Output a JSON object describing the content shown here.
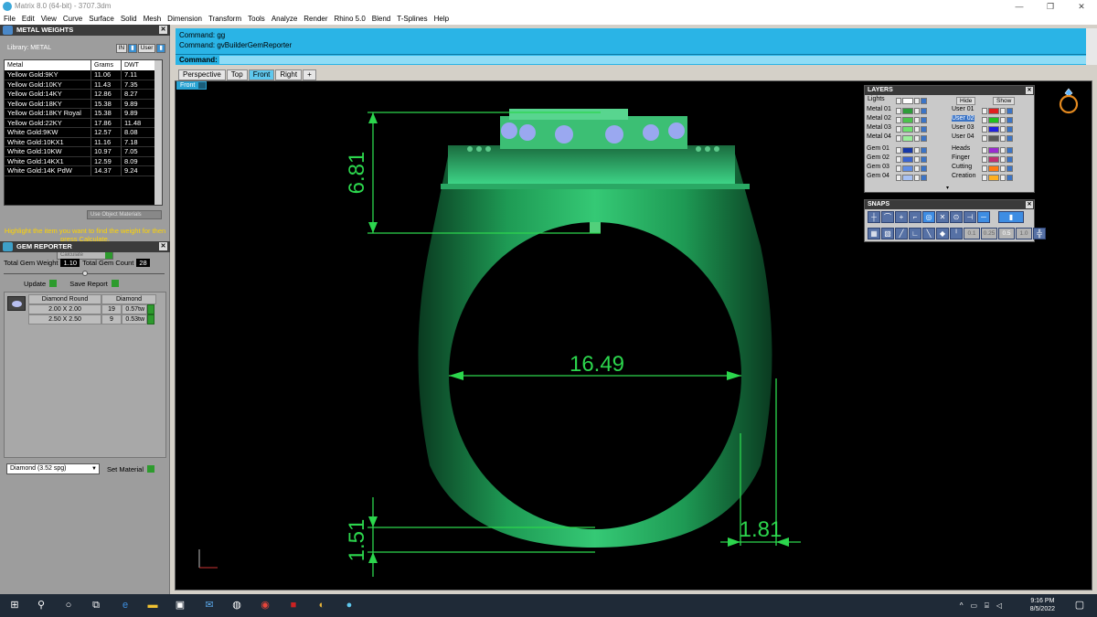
{
  "window": {
    "title": "Matrix 8.0 (64-bit) - 3707.3dm",
    "controls": [
      "—",
      "❐",
      "✕"
    ]
  },
  "menu": [
    "File",
    "Edit",
    "View",
    "Curve",
    "Surface",
    "Solid",
    "Mesh",
    "Dimension",
    "Transform",
    "Tools",
    "Analyze",
    "Render",
    "Rhino 5.0",
    "Blend",
    "T-Splines",
    "Help"
  ],
  "metal_weights": {
    "title": "METAL WEIGHTS",
    "library_label": "Library: METAL",
    "tabs": [
      "IN",
      "User"
    ],
    "columns": [
      "Metal",
      "Grams",
      "DWT"
    ],
    "rows": [
      [
        "Yellow Gold:9KY",
        "11.06",
        "7.11"
      ],
      [
        "Yellow Gold:10KY",
        "11.43",
        "7.35"
      ],
      [
        "Yellow Gold:14KY",
        "12.86",
        "8.27"
      ],
      [
        "Yellow Gold:18KY",
        "15.38",
        "9.89"
      ],
      [
        "Yellow Gold:18KY Royal",
        "15.38",
        "9.89"
      ],
      [
        "Yellow Gold:22KY",
        "17.86",
        "11.48"
      ],
      [
        "White Gold:9KW",
        "12.57",
        "8.08"
      ],
      [
        "White Gold:10KX1",
        "11.16",
        "7.18"
      ],
      [
        "White Gold:10KW",
        "10.97",
        "7.05"
      ],
      [
        "White Gold:14KX1",
        "12.59",
        "8.09"
      ],
      [
        "White Gold:14K PdW",
        "14.37",
        "9.24"
      ]
    ],
    "use_object_materials": "Use Object Materials",
    "hint": "Highlight the item you want to find the weight for then press Calculate.",
    "calculate": "Calculate"
  },
  "gem_reporter": {
    "title": "GEM REPORTER",
    "total_weight_label": "Total Gem Weight",
    "total_weight": "1.10",
    "total_count_label": "Total Gem Count",
    "total_count": "28",
    "update": "Update",
    "save_report": "Save Report",
    "col_shape": "Diamond Round",
    "col_material": "Diamond",
    "rows": [
      {
        "size": "2.00 X 2.00",
        "count": "19",
        "weight": "0.57tw"
      },
      {
        "size": "2.50 X 2.50",
        "count": "9",
        "weight": "0.53tw"
      }
    ],
    "material_select": "Diamond     (3.52 spg)",
    "set_material": "Set Material"
  },
  "command": {
    "history": [
      "Command: gg",
      "Command: gvBuilderGemReporter"
    ],
    "prompt_label": "Command:"
  },
  "view_tabs": [
    "Perspective",
    "Top",
    "Front",
    "Right",
    "+"
  ],
  "active_view": "Front",
  "dimensions": {
    "top_height": "6.81",
    "inner_diameter": "16.49",
    "bottom_thickness": "1.51",
    "side_width": "1.81"
  },
  "layers": {
    "title": "LAYERS",
    "lights": "Lights",
    "hide": "Hide",
    "show": "Show",
    "left": [
      {
        "name": "Metal 01",
        "color": "#2e9c3a"
      },
      {
        "name": "Metal 02",
        "color": "#4cc24c"
      },
      {
        "name": "Metal 03",
        "color": "#6fe26f"
      },
      {
        "name": "Metal 04",
        "color": "#9bef9b"
      },
      {
        "name": "Gem 01",
        "color": "#1638a8"
      },
      {
        "name": "Gem 02",
        "color": "#3a64d0"
      },
      {
        "name": "Gem 03",
        "color": "#5f8de6"
      },
      {
        "name": "Gem 04",
        "color": "#a7c1f3"
      }
    ],
    "right": [
      {
        "name": "User 01",
        "color": "#e02020"
      },
      {
        "name": "User 02",
        "color": "#20c020"
      },
      {
        "name": "User 03",
        "color": "#2020e0"
      },
      {
        "name": "User 04",
        "color": "#5a5a5a"
      },
      {
        "name": "Heads",
        "color": "#9a2bd0"
      },
      {
        "name": "Finger",
        "color": "#c03070"
      },
      {
        "name": "Cutting",
        "color": "#ff7a10"
      },
      {
        "name": "Creation",
        "color": "#ffb020"
      }
    ]
  },
  "snaps": {
    "title": "SNAPS",
    "values": [
      "0.1",
      "0.25",
      "0.5",
      "1.0"
    ]
  },
  "taskbar": {
    "time": "9:16 PM",
    "date": "8/5/2022"
  }
}
